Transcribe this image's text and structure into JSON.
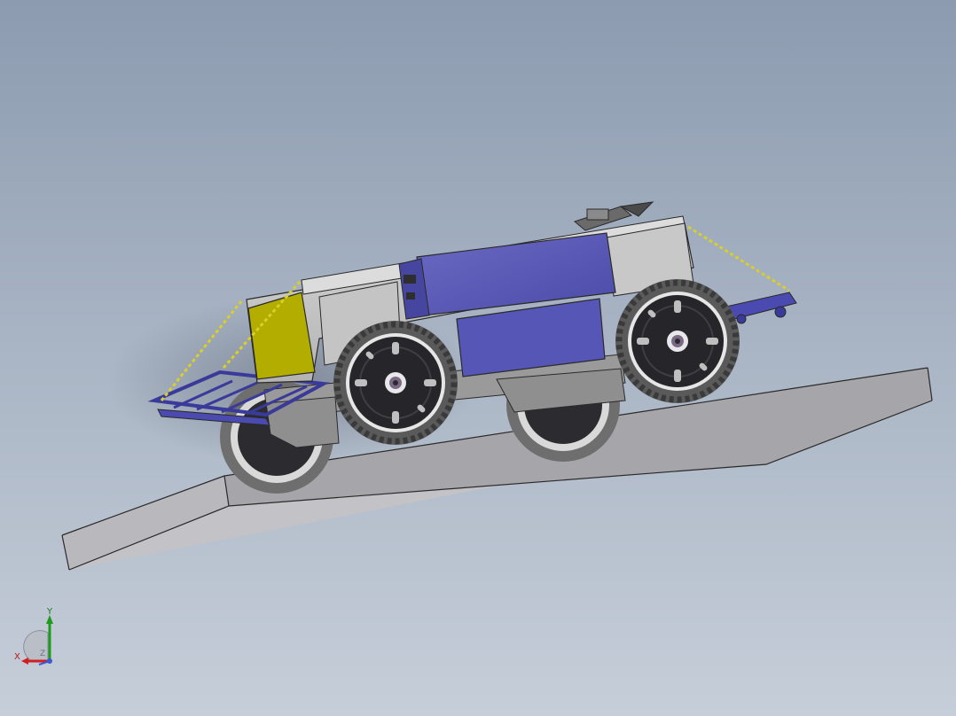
{
  "viewport": {
    "background_top": "#8c9bb0",
    "background_bottom": "#c6ced9"
  },
  "model": {
    "part_colors": {
      "body": "#c8c8c8",
      "accent_panels": "#5a5ab4",
      "side_cover": "#b4ae00",
      "chains": "#d8cf2a",
      "tire": "#e2e2e2",
      "hub": "#2a2a2e",
      "ramp_top": "#c4c4c8",
      "ramp_side": "#a3a3a7"
    }
  },
  "triad": {
    "y_label": "Y",
    "x_label": "X",
    "z_label": "Z",
    "y_color": "#1e9a1e",
    "x_color": "#d21e1e",
    "z_color": "#3a5ad0"
  }
}
